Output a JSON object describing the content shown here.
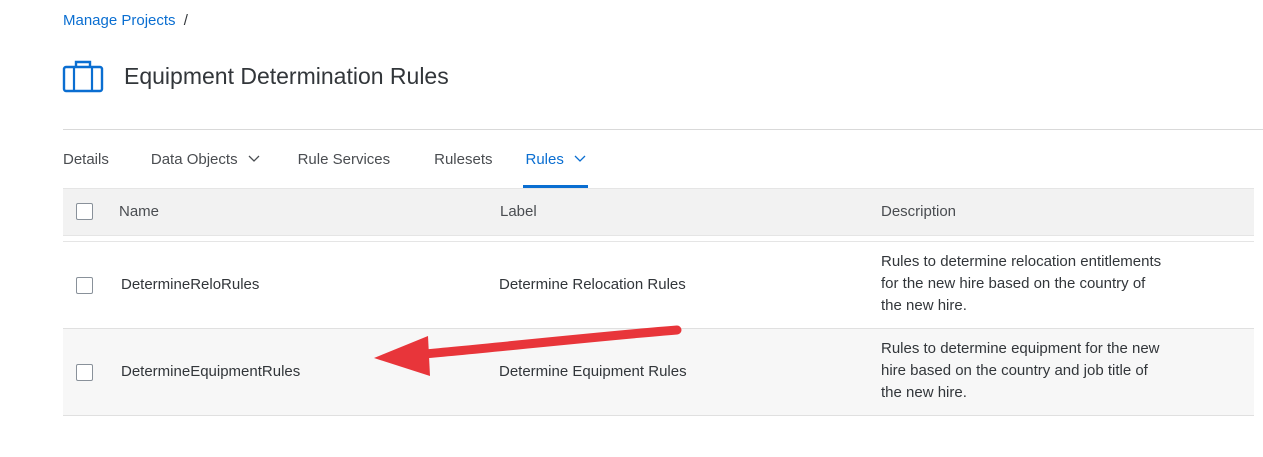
{
  "breadcrumb": {
    "link": "Manage Projects",
    "separator": "/"
  },
  "page": {
    "title": "Equipment Determination Rules",
    "icon": "briefcase-icon"
  },
  "tabs": [
    {
      "label": "Details",
      "has_dropdown": false,
      "active": false
    },
    {
      "label": "Data Objects",
      "has_dropdown": true,
      "active": false
    },
    {
      "label": "Rule Services",
      "has_dropdown": false,
      "active": false
    },
    {
      "label": "Rulesets",
      "has_dropdown": false,
      "active": false
    },
    {
      "label": "Rules",
      "has_dropdown": true,
      "active": true
    }
  ],
  "table": {
    "columns": [
      "Name",
      "Label",
      "Description"
    ],
    "rows": [
      {
        "name": "DetermineReloRules",
        "label": "Determine Relocation Rules",
        "description": [
          "Rules to determine relocation entitlements",
          "for the new hire based on the country of",
          "the new hire."
        ]
      },
      {
        "name": "DetermineEquipmentRules",
        "label": "Determine Equipment Rules",
        "description": [
          "Rules to determine equipment for the new",
          "hire based on the country and job title of",
          "the new hire."
        ]
      }
    ]
  },
  "annotation": {
    "arrow_color": "#e8353a",
    "arrow": "red-arrow-pointing-to-DetermineEquipmentRules"
  },
  "colors": {
    "accent": "#0a6ed1",
    "text": "#32363a",
    "header_bg": "#f2f2f2"
  }
}
